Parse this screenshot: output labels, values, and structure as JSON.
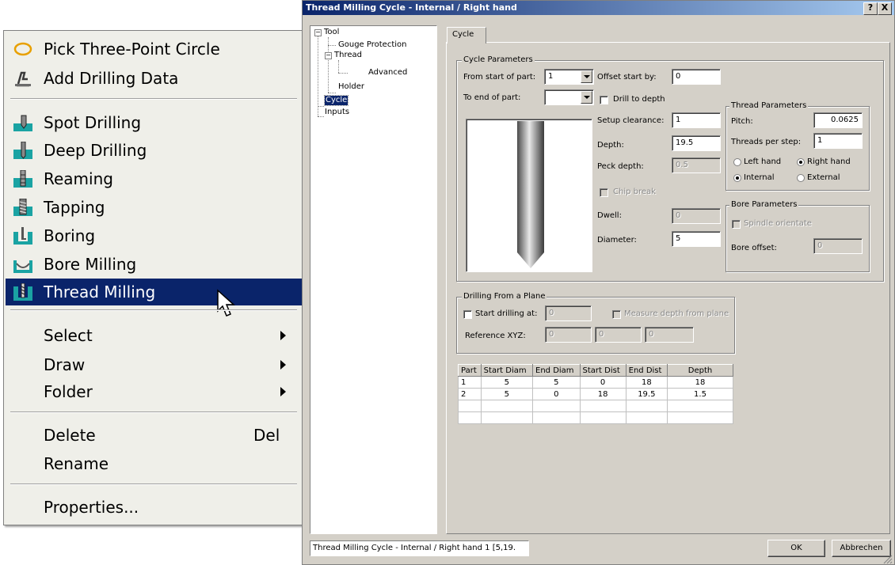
{
  "context_menu": {
    "items": [
      {
        "label": "Pick Three-Point Circle",
        "icon": "circle-pick-icon"
      },
      {
        "label": "Add Drilling Data",
        "icon": "drilling-data-icon"
      },
      {
        "label": "Spot Drilling",
        "icon": "spot-drilling-icon"
      },
      {
        "label": "Deep Drilling",
        "icon": "deep-drilling-icon"
      },
      {
        "label": "Reaming",
        "icon": "reaming-icon"
      },
      {
        "label": "Tapping",
        "icon": "tapping-icon"
      },
      {
        "label": "Boring",
        "icon": "boring-icon"
      },
      {
        "label": "Bore Milling",
        "icon": "bore-milling-icon"
      },
      {
        "label": "Thread Milling",
        "icon": "thread-milling-icon",
        "selected": true
      },
      {
        "label": "Select"
      },
      {
        "label": "Draw"
      },
      {
        "label": "Folder"
      },
      {
        "label": "Delete",
        "shortcut": "Del"
      },
      {
        "label": "Rename"
      },
      {
        "label": "Properties..."
      }
    ]
  },
  "dialog": {
    "title": "Thread Milling Cycle - Internal / Right hand",
    "help": "?",
    "close": "X",
    "tree": [
      "Tool",
      "Gouge Protection",
      "Thread",
      "Advanced",
      "Holder",
      "Cycle",
      "Inputs"
    ],
    "tab": "Cycle",
    "cycle_params": {
      "title": "Cycle Parameters",
      "from_start_label": "From start of part:",
      "from_start_value": "1",
      "to_end_label": "To end of part:",
      "to_end_value": "",
      "offset_label": "Offset start by:",
      "offset_value": "0",
      "drill_to_depth": "Drill to depth",
      "setup_clearance_label": "Setup clearance:",
      "setup_clearance_value": "1",
      "depth_label": "Depth:",
      "depth_value": "19.5",
      "peck_depth_label": "Peck depth:",
      "peck_depth_value": "0.5",
      "chip_break": "Chip break",
      "dwell_label": "Dwell:",
      "dwell_value": "0",
      "diameter_label": "Diameter:",
      "diameter_value": "5"
    },
    "thread_params": {
      "title": "Thread Parameters",
      "pitch_label": "Pitch:",
      "pitch_value": "0.0625",
      "threads_label": "Threads per step:",
      "threads_value": "1",
      "left_hand": "Left hand",
      "right_hand": "Right hand",
      "internal": "Internal",
      "external": "External"
    },
    "bore_params": {
      "title": "Bore Parameters",
      "spindle_orientate": "Spindle orientate",
      "bore_offset_label": "Bore offset:",
      "bore_offset_value": "0"
    },
    "plane": {
      "title": "Drilling From a Plane",
      "start_drilling": "Start drilling at:",
      "start_value": "0",
      "measure_depth": "Measure depth from plane",
      "ref_label": "Reference XYZ:",
      "ref_x": "0",
      "ref_y": "0",
      "ref_z": "0"
    },
    "table": {
      "headers": [
        "Part",
        "Start Diam",
        "End Diam",
        "Start Dist",
        "End Dist",
        "Depth"
      ],
      "rows": [
        [
          "1",
          "5",
          "5",
          "0",
          "18",
          "18"
        ],
        [
          "2",
          "5",
          "0",
          "18",
          "19.5",
          "1.5"
        ],
        [
          "",
          "",
          "",
          "",
          "",
          ""
        ],
        [
          "",
          "",
          "",
          "",
          "",
          ""
        ]
      ]
    },
    "status": "Thread Milling Cycle - Internal / Right hand 1 [5,19.",
    "ok": "OK",
    "cancel": "Abbrechen"
  }
}
